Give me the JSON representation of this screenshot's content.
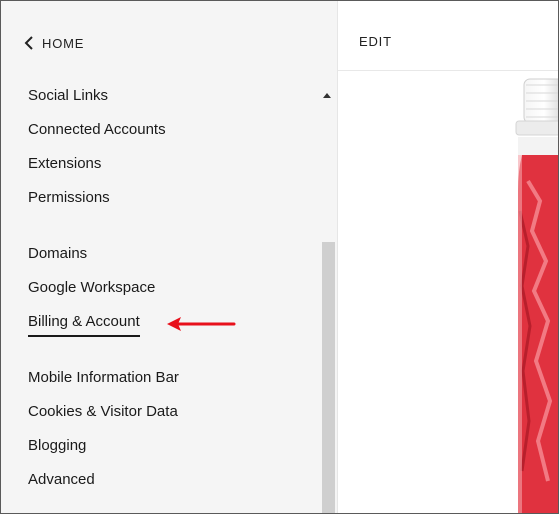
{
  "nav": {
    "back_label": "HOME"
  },
  "menu": {
    "items": [
      "Social Links",
      "Connected Accounts",
      "Extensions",
      "Permissions",
      "Domains",
      "Google Workspace",
      "Billing & Account",
      "Mobile Information Bar",
      "Cookies & Visitor Data",
      "Blogging",
      "Advanced"
    ],
    "active_item": "Billing & Account"
  },
  "editor": {
    "edit_label": "EDIT"
  },
  "colors": {
    "sidebar_bg": "#f5f5f5",
    "annotation_arrow": "#e8101b",
    "jar_red": "#e0323f"
  },
  "icons": {
    "back": "chevron-left-icon",
    "scroll_up": "triangle-up-icon",
    "annotation": "red-arrow-icon"
  }
}
